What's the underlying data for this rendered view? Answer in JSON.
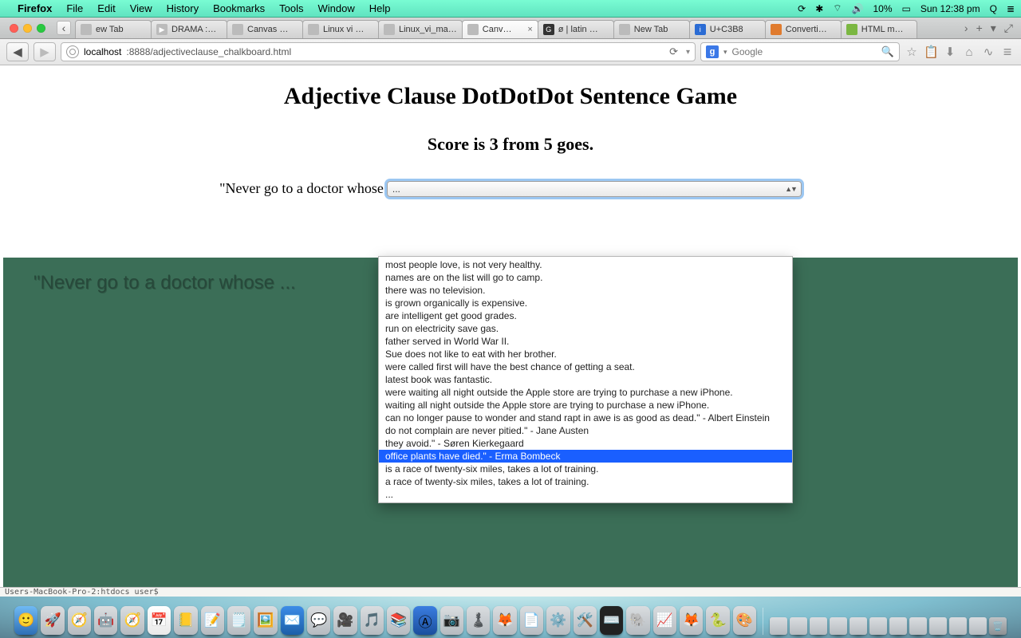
{
  "os": {
    "app": "Firefox",
    "menus": [
      "File",
      "Edit",
      "View",
      "History",
      "Bookmarks",
      "Tools",
      "Window",
      "Help"
    ],
    "battery": "10%",
    "clock": "Sun 12:38 pm"
  },
  "tabs": [
    {
      "label": "ew Tab"
    },
    {
      "label": "DRAMA :…"
    },
    {
      "label": "Canvas …"
    },
    {
      "label": "Linux vi …"
    },
    {
      "label": "Linux_vi_ma…"
    },
    {
      "label": "Canv…",
      "active": true
    },
    {
      "label": "ø | latin …"
    },
    {
      "label": "New Tab"
    },
    {
      "label": "U+C3B8"
    },
    {
      "label": "Converti…"
    },
    {
      "label": "HTML m…"
    }
  ],
  "url": {
    "host": "localhost",
    "rest": ":8888/adjectiveclause_chalkboard.html"
  },
  "search": {
    "engine": "Google"
  },
  "page": {
    "title": "Adjective Clause DotDotDot Sentence Game",
    "score": "Score is 3 from 5 goes.",
    "prompt_prefix": "\"Never go to a doctor whose",
    "select_display": "...",
    "chalk_line": "\"Never go to a doctor whose ...",
    "options": [
      "most people love, is not very healthy.",
      "names are on the list will go to camp.",
      "there was no television.",
      "is grown organically is expensive.",
      "are intelligent get good grades.",
      "run on electricity save gas.",
      "father served in World War II.",
      "Sue does not like to eat with her brother.",
      "were called first will have the best chance of getting a seat.",
      "latest book was fantastic.",
      "were waiting all night outside the Apple store are trying to purchase a new iPhone.",
      "waiting all night outside the Apple store are trying to purchase a new iPhone.",
      "can no longer pause to wonder and stand rapt in awe is as good as dead.\" - Albert Einstein",
      "do not complain are never pitied.\" - Jane Austen",
      "they avoid.\" - Søren Kierkegaard",
      "office plants have died.\" - Erma Bombeck",
      "is a race of twenty-six miles, takes a lot of training.",
      "a race of twenty-six miles, takes a lot of training.",
      "..."
    ],
    "selected_index": 15
  },
  "terminal_strip": "Users-MacBook-Pro-2:htdocs user$"
}
